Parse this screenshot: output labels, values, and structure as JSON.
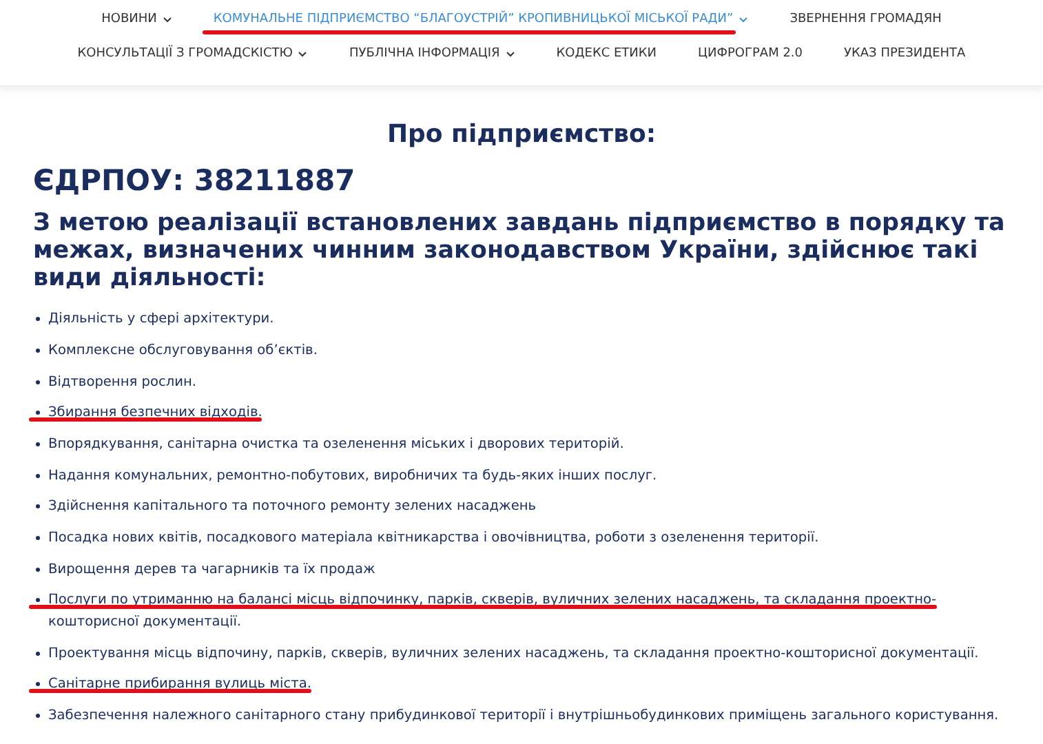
{
  "nav": {
    "upper_row": [
      {
        "label": "НОВИНИ",
        "dropdown": true,
        "selected": false,
        "marked": false
      },
      {
        "label": "КОМУНАЛЬНЕ ПІДПРИЄМСТВО “БЛАГОУСТРІЙ” КРОПИВНИЦЬКОЇ МІСЬКОЇ РАДИ”",
        "dropdown": true,
        "selected": true,
        "marked": true
      },
      {
        "label": "ЗВЕРНЕННЯ ГРОМАДЯН",
        "dropdown": false,
        "selected": false,
        "marked": false
      }
    ],
    "lower_row": [
      {
        "label": "КОНСУЛЬТАЦІЇ З ГРОМАДСКІСТЮ",
        "dropdown": true,
        "selected": false,
        "marked": false
      },
      {
        "label": "ПУБЛІЧНА ІНФОРМАЦІЯ",
        "dropdown": true,
        "selected": false,
        "marked": false
      },
      {
        "label": "КОДЕКС ЕТИКИ",
        "dropdown": false,
        "selected": false,
        "marked": false
      },
      {
        "label": "ЦИФРОГРАМ 2.0",
        "dropdown": false,
        "selected": false,
        "marked": false
      },
      {
        "label": "УКАЗ ПРЕЗИДЕНТА",
        "dropdown": false,
        "selected": false,
        "marked": false
      }
    ]
  },
  "content": {
    "title": "Про підприємство:",
    "edrpou": "ЄДРПОУ: 38211887",
    "intro": "З метою реалізації встановлених завдань підприємство в порядку та межах, визначених чинним законодавством України, здійснює такі види діяльності:",
    "activities": [
      {
        "text": "Діяльність у сфері архітектури.",
        "marked": false
      },
      {
        "text": "Комплексне обслуговування об’єктів.",
        "marked": false
      },
      {
        "text": "Відтворення рослин.",
        "marked": false
      },
      {
        "text": "Збирання безпечних відходів.",
        "marked": true
      },
      {
        "text": "Впорядкування, санітарна очистка та озеленення міських і дворових територій.",
        "marked": false
      },
      {
        "text": "Надання комунальних, ремонтно-побутових, виробничих та будь-яких інших послуг.",
        "marked": false
      },
      {
        "text": "Здійснення капітального та поточного ремонту зелених насаджень",
        "marked": false
      },
      {
        "text": "Посадка нових квітів, посадкового матеріала квітникарства і овочівництва, роботи з озеленення території.",
        "marked": false
      },
      {
        "text": "Вирощення дерев та чагарників та їх продаж",
        "marked": false
      },
      {
        "text": "Послуги по утриманню на балансі місць відпочинку, парків, скверів, вуличних зелених насаджень, та складання проектно-кошторисної документації.",
        "marked": true
      },
      {
        "text": "Проектування місць відпочину, парків, скверів, вуличних зелених насаджень, та складання проектно-кошторисної документації.",
        "marked": false
      },
      {
        "text": "Санітарне прибирання вулиць міста.",
        "marked": true
      },
      {
        "text": "Забезпечення належного санітарного стану прибудинкової території і внутрішньобудинкових приміщень загального користування.",
        "marked": false
      }
    ]
  }
}
